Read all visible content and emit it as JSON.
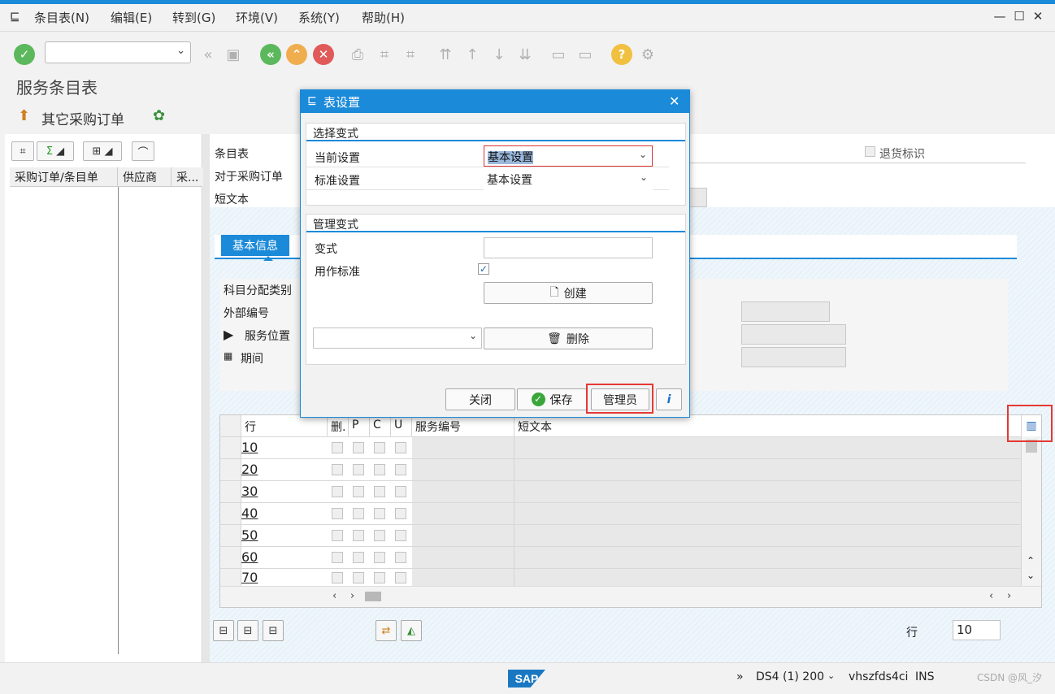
{
  "menubar": {
    "items": [
      "条目表(N)",
      "编辑(E)",
      "转到(G)",
      "环境(V)",
      "系统(Y)",
      "帮助(H)"
    ]
  },
  "window_controls": {
    "min": "—",
    "max": "☐",
    "close": "✕"
  },
  "page_title": "服务条目表",
  "appbar": {
    "other_po_label": "其它采购订单"
  },
  "left_pane": {
    "columns": [
      "采购订单/条目单",
      "供应商",
      "采..."
    ],
    "toolbar": {
      "binoculars": "",
      "sum": "Σ"
    }
  },
  "header_fields": {
    "entry_sheet": "条目表",
    "for_po": "对于采购订单",
    "short_text": "短文本",
    "return_flag": "退货标识"
  },
  "tabs": {
    "basic_info": "基本信息"
  },
  "form_fields": {
    "acct_assignment": "科目分配类别",
    "external_number": "外部编号",
    "service_location": "服务位置",
    "period": "期间"
  },
  "grid": {
    "headers": [
      "行",
      "删.",
      "P",
      "C",
      "U",
      "服务编号",
      "短文本"
    ],
    "rows": [
      "10",
      "20",
      "30",
      "40",
      "50",
      "60",
      "70"
    ]
  },
  "bottom": {
    "row_label": "行",
    "row_value": "10"
  },
  "status": {
    "system": "DS4 (1) 200",
    "host": "vhszfds4ci",
    "mode": "INS",
    "sap_logo": "SAP",
    "arrows": "»",
    "watermark": "CSDN @风_汐"
  },
  "dialog": {
    "title": "表设置",
    "select_variant_group": "选择变式",
    "current_setting_label": "当前设置",
    "current_setting_value": "基本设置",
    "standard_setting_label": "标准设置",
    "standard_setting_value": "基本设置",
    "manage_variant_group": "管理变式",
    "variant_label": "变式",
    "variant_value": "",
    "use_as_standard_label": "用作标准",
    "create_button": "创建",
    "delete_button": "删除",
    "delete_select_value": "",
    "close_button": "关闭",
    "save_button": "保存",
    "admin_button": "管理员",
    "info_button": "i"
  },
  "colors": {
    "accent": "#1b8ad9",
    "highlight": "#e53935"
  }
}
